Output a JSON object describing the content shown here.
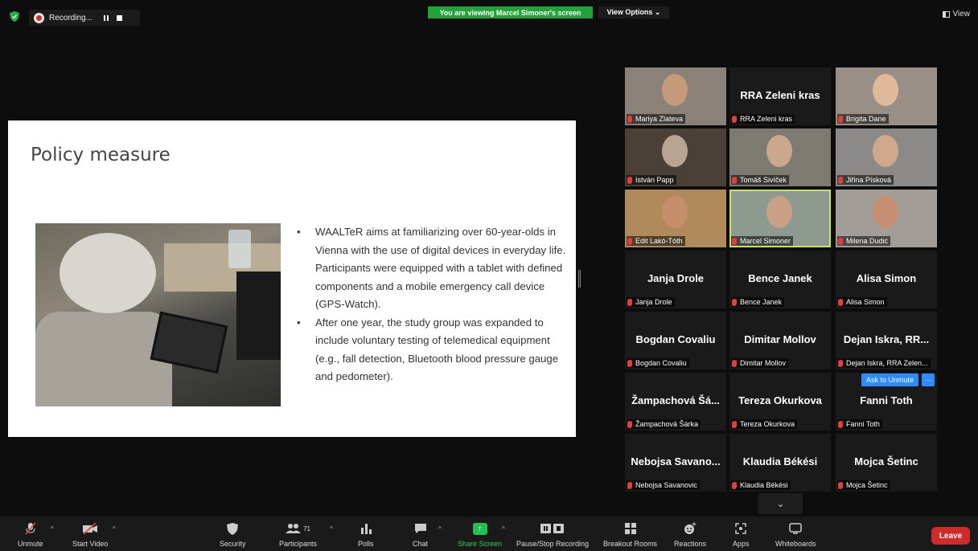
{
  "top": {
    "recording_label": "Recording...",
    "viewing_banner": "You are viewing Marcel Simoner's screen",
    "view_options": "View Options ⌄",
    "view_label": "View"
  },
  "slide": {
    "title": "Policy measure",
    "bullets": [
      "WAALTeR aims at familiarizing over 60-year-olds in Vienna with the use of digital devices in everyday life. Participants were equipped with a tablet with defined components and a mobile emergency call device (GPS-Watch).",
      "After one year, the study group was expanded to include voluntary testing of telemedical equipment (e.g., fall detection, Bluetooth blood pressure gauge and pedometer)."
    ]
  },
  "participants": [
    {
      "name": "Mariya Zlateva",
      "video": true,
      "bg": "#8a8178",
      "face": "#c49a7a"
    },
    {
      "name": "RRA Zeleni kras",
      "big": "RRA Zeleni kras",
      "video": false
    },
    {
      "name": "Brigita Dane",
      "video": true,
      "bg": "#9a8f86",
      "face": "#e0b89a"
    },
    {
      "name": "István Papp",
      "video": true,
      "bg": "#4a4038",
      "face": "#b9a492"
    },
    {
      "name": "Tomáš Sivíček",
      "video": true,
      "bg": "#7d7a72",
      "face": "#c9a88e"
    },
    {
      "name": "Jiřina Písková",
      "video": true,
      "bg": "#8b8a88",
      "face": "#d2a88a"
    },
    {
      "name": "Edit Lakó-Tóth",
      "video": true,
      "bg": "#b08a5a",
      "face": "#c78e6b"
    },
    {
      "name": "Marcel Simoner",
      "video": true,
      "bg": "#8e9990",
      "face": "#c99f86",
      "active": true
    },
    {
      "name": "Milena Dudić",
      "video": true,
      "bg": "#a39d98",
      "face": "#c68f72"
    },
    {
      "name": "Janja Drole",
      "big": "Janja Drole",
      "video": false
    },
    {
      "name": "Bence Janek",
      "big": "Bence Janek",
      "video": false
    },
    {
      "name": "Alisa Simon",
      "big": "Alisa Simon",
      "video": false
    },
    {
      "name": "Bogdan Covaliu",
      "big": "Bogdan Covaliu",
      "video": false
    },
    {
      "name": "Dimitar Mollov",
      "big": "Dimitar Mollov",
      "video": false
    },
    {
      "name": "Dejan Iskra, RRA Zelen...",
      "big": "Dejan Iskra, RR...",
      "video": false
    },
    {
      "name": "Žampachová Šárka",
      "big": "Žampachová Šá...",
      "video": false
    },
    {
      "name": "Tereza Okurkova",
      "big": "Tereza Okurkova",
      "video": false
    },
    {
      "name": "Fanni Toth",
      "big": "Fanni Toth",
      "video": false
    },
    {
      "name": "Nebojsa Savanovic",
      "big": "Nebojsa Savano...",
      "video": false
    },
    {
      "name": "Klaudia Békési",
      "big": "Klaudia Békési",
      "video": false
    },
    {
      "name": "Mojca Šetinc",
      "big": "Mojca Šetinc",
      "video": false
    }
  ],
  "ask_to_unmute": "Ask to Unmute",
  "more": "···",
  "toolbar": {
    "unmute": "Unmute",
    "start_video": "Start Video",
    "security": "Security",
    "participants": "Participants",
    "participants_count": "71",
    "polls": "Polls",
    "chat": "Chat",
    "share_screen": "Share Screen",
    "pause_recording": "Pause/Stop Recording",
    "breakout_rooms": "Breakout Rooms",
    "reactions": "Reactions",
    "apps": "Apps",
    "whiteboards": "Whiteboards",
    "leave": "Leave"
  }
}
